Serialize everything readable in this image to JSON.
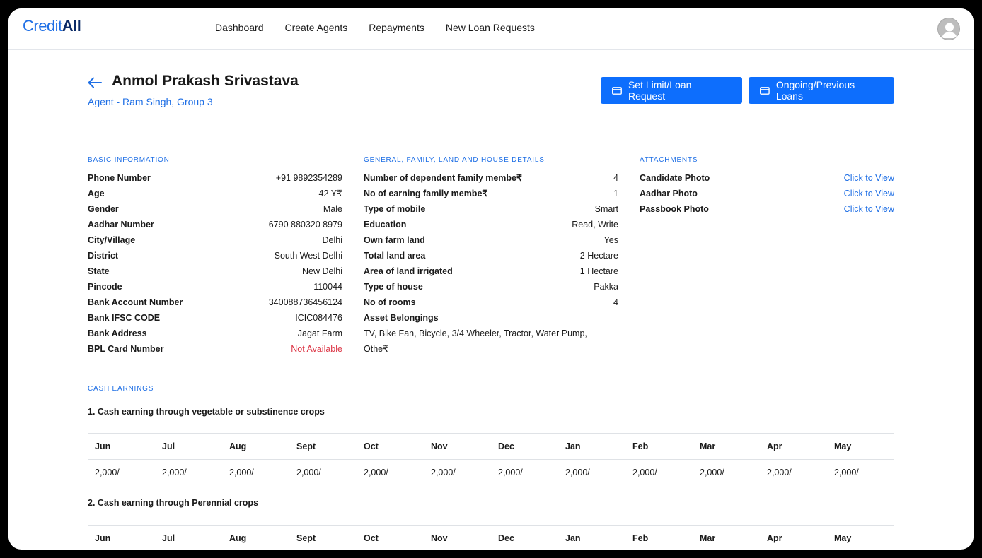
{
  "brand": {
    "part1": "Credit",
    "part2": "All"
  },
  "nav": {
    "items": [
      "Dashboard",
      "Create Agents",
      "Repayments",
      "New Loan Requests"
    ]
  },
  "profile": {
    "name": "Anmol Prakash Srivastava",
    "subtitle": "Agent - Ram Singh, Group 3"
  },
  "actions": {
    "limit_label": "Set Limit/Loan Request",
    "loans_label": "Ongoing/Previous Loans"
  },
  "basic": {
    "title": "BASIC INFORMATION",
    "rows": [
      {
        "label": "Phone Number",
        "value": "+91 9892354289"
      },
      {
        "label": "Age",
        "value": "42 Y₹"
      },
      {
        "label": "Gender",
        "value": "Male"
      },
      {
        "label": "Aadhar Number",
        "value": "6790 880320 8979"
      },
      {
        "label": "City/Village",
        "value": "Delhi"
      },
      {
        "label": "District",
        "value": "South West Delhi"
      },
      {
        "label": "State",
        "value": "New Delhi"
      },
      {
        "label": "Pincode",
        "value": "110044"
      },
      {
        "label": "Bank Account Number",
        "value": "340088736456124"
      },
      {
        "label": "Bank IFSC CODE",
        "value": "ICIC084476"
      },
      {
        "label": "Bank Address",
        "value": "Jagat Farm"
      },
      {
        "label": "BPL Card Number",
        "value": "Not Available"
      }
    ]
  },
  "general": {
    "title": "GENERAL, FAMILY, LAND AND HOUSE DETAILS",
    "rows": [
      {
        "label": "Number of dependent family membe₹",
        "value": "4"
      },
      {
        "label": "No of earning family membe₹",
        "value": "1"
      },
      {
        "label": "Type of mobile",
        "value": "Smart"
      },
      {
        "label": "Education",
        "value": "Read, Write"
      },
      {
        "label": "Own farm land",
        "value": "Yes"
      },
      {
        "label": "Total land area",
        "value": "2 Hectare"
      },
      {
        "label": "Area of land irrigated",
        "value": "1 Hectare"
      },
      {
        "label": "Type of house",
        "value": "Pakka"
      },
      {
        "label": "No of rooms",
        "value": "4"
      }
    ],
    "asset_label": "Asset Belongings",
    "asset_value": "TV, Bike Fan, Bicycle, 3/4 Wheeler, Tractor, Water Pump, Othe₹"
  },
  "attachments": {
    "title": "ATTACHMENTS",
    "rows": [
      {
        "label": "Candidate Photo",
        "value": "Click to View"
      },
      {
        "label": "Aadhar Photo",
        "value": "Click to View"
      },
      {
        "label": "Passbook Photo",
        "value": "Click to View"
      }
    ]
  },
  "cash": {
    "title": "CASH EARNINGS",
    "months": [
      "Jun",
      "Jul",
      "Aug",
      "Sept",
      "Oct",
      "Nov",
      "Dec",
      "Jan",
      "Feb",
      "Mar",
      "Apr",
      "May"
    ],
    "sections": [
      {
        "title": "1. Cash earning through vegetable or substinence crops",
        "values": [
          "2,000/-",
          "2,000/-",
          "2,000/-",
          "2,000/-",
          "2,000/-",
          "2,000/-",
          "2,000/-",
          "2,000/-",
          "2,000/-",
          "2,000/-",
          "2,000/-",
          "2,000/-"
        ]
      },
      {
        "title": "2. Cash earning through Perennial crops"
      }
    ]
  },
  "colors": {
    "accent": "#0d6efd",
    "link": "#1f6fe5",
    "danger": "#dc3545"
  }
}
